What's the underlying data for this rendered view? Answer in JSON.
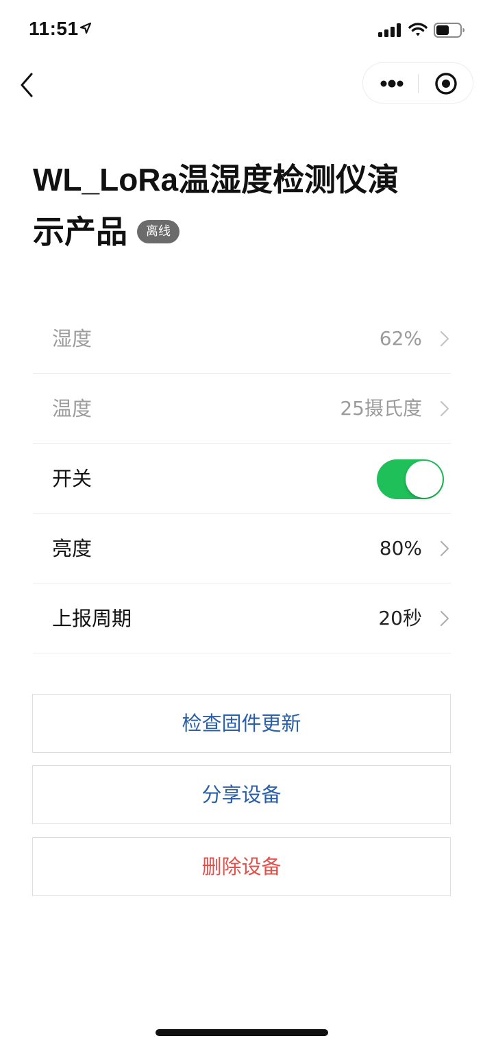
{
  "status_bar": {
    "time": "11:51",
    "icons": [
      "location-arrow-icon",
      "signal-icon",
      "wifi-icon",
      "battery-icon"
    ]
  },
  "nav": {
    "back_icon": "chevron-left-icon",
    "more_icon": "more-dots-icon",
    "close_icon": "target-circle-icon"
  },
  "device": {
    "title_line1": "WL_LoRa温湿度检测仪演",
    "title_line2": "示产品",
    "status_badge": "离线"
  },
  "properties": [
    {
      "label": "湿度",
      "value": "62%",
      "disabled": true
    },
    {
      "label": "温度",
      "value": "25摄氏度",
      "disabled": true
    },
    {
      "label": "开关",
      "toggle": true,
      "toggle_on": true
    },
    {
      "label": "亮度",
      "value": "80%"
    },
    {
      "label": "上报周期",
      "value": "20秒"
    }
  ],
  "actions": {
    "check_firmware": "检查固件更新",
    "share_device": "分享设备",
    "delete_device": "删除设备"
  },
  "colors": {
    "toggle_on": "#1fbf5a",
    "action_blue": "#2b5fa8",
    "action_red": "#e0524a",
    "badge_bg": "#6b6b6b"
  }
}
